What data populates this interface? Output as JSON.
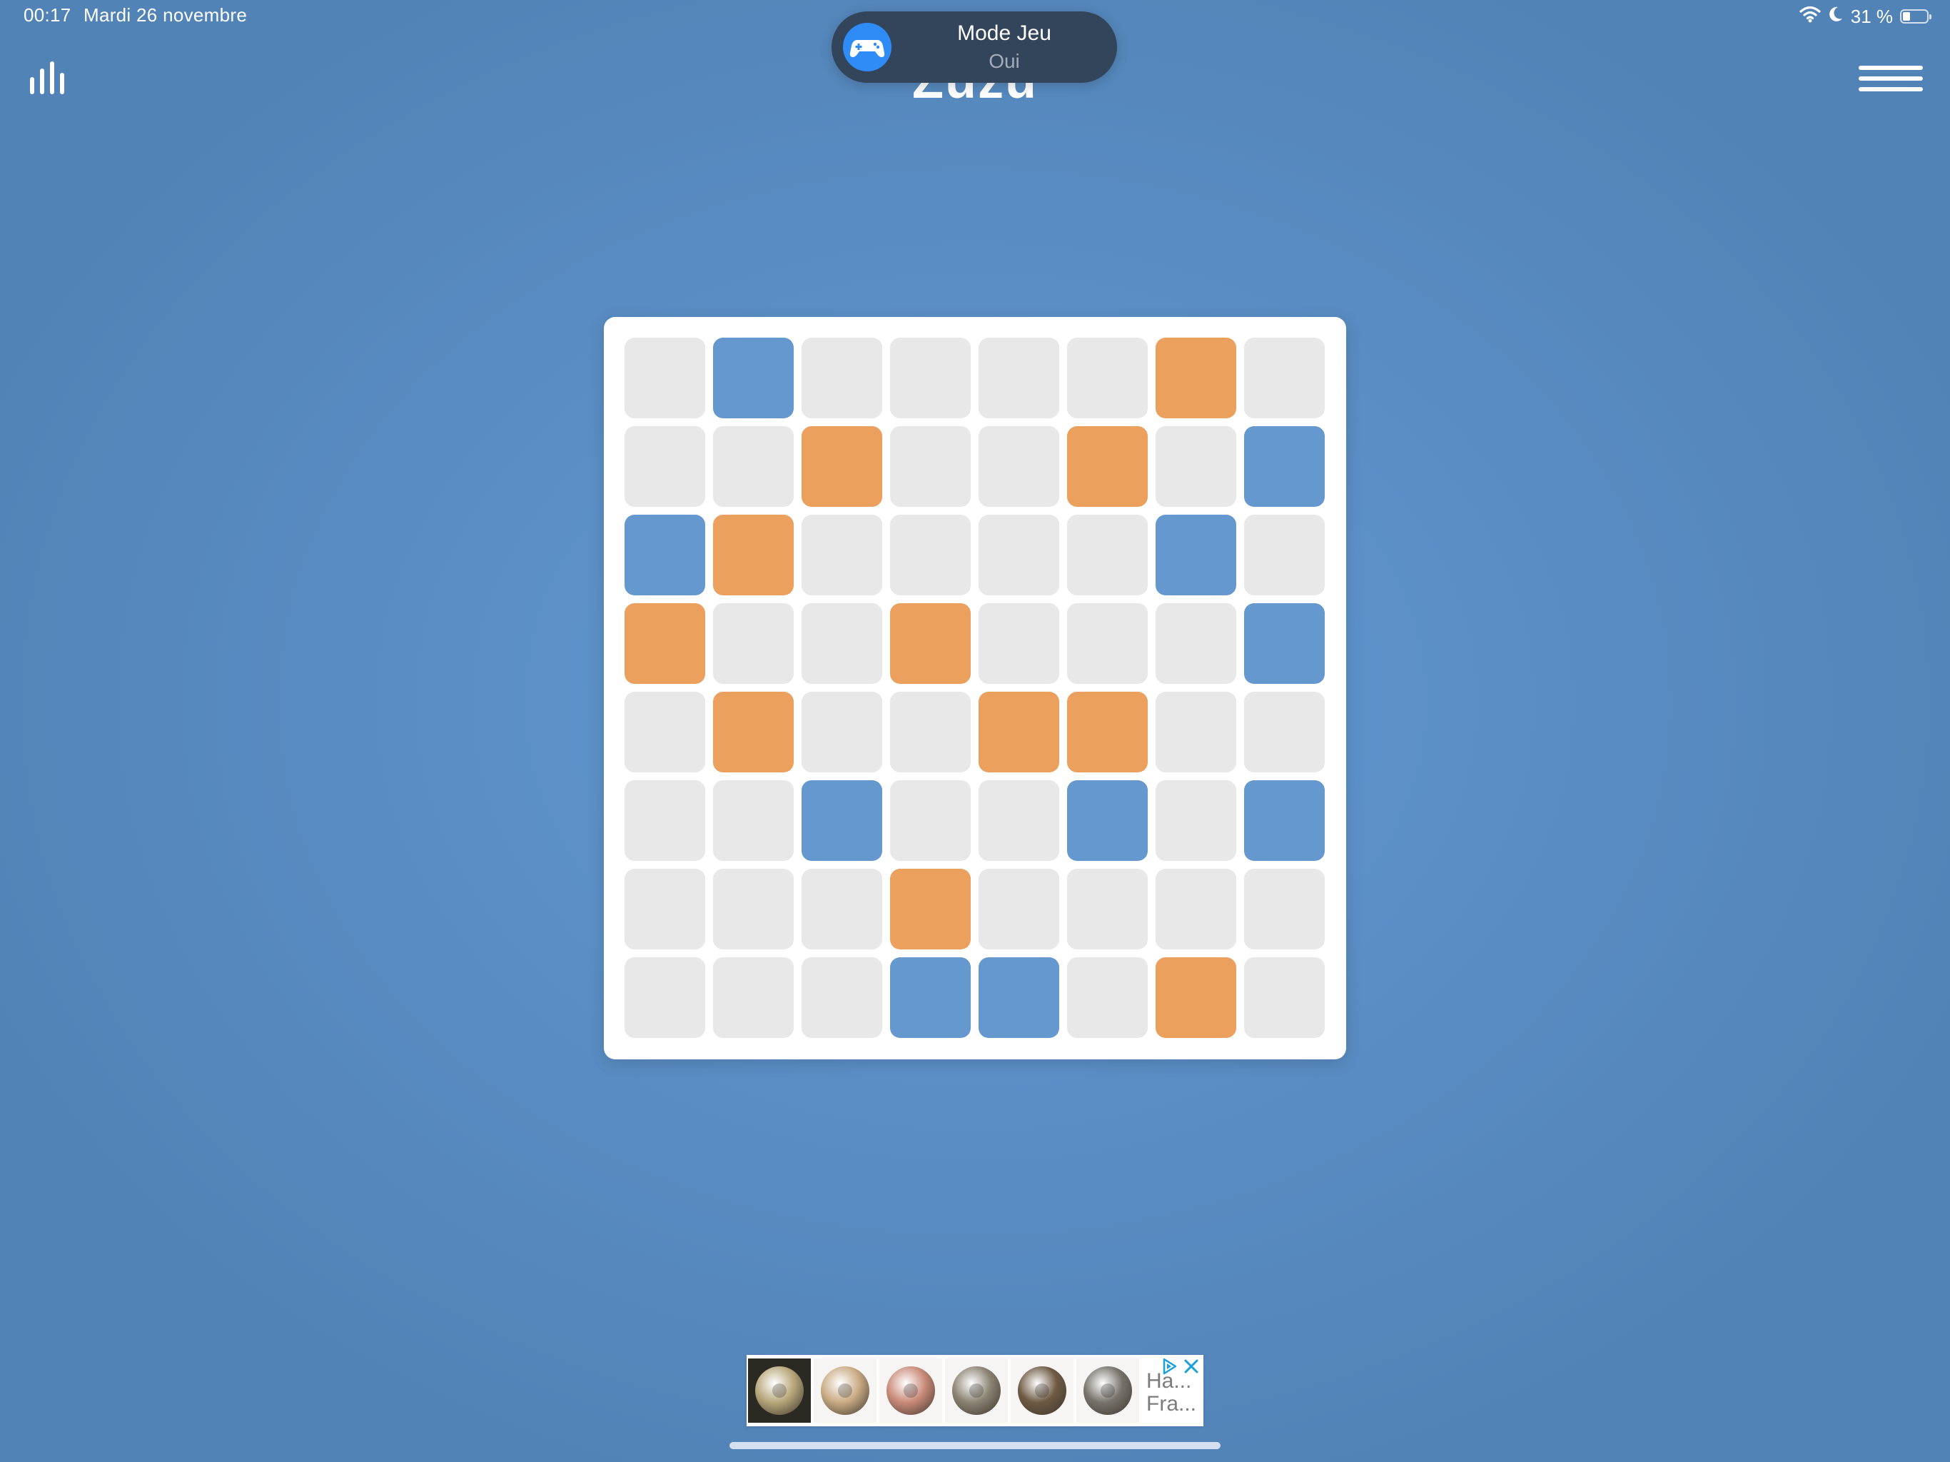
{
  "status_bar": {
    "time": "00:17",
    "date": "Mardi 26 novembre",
    "battery_text": "31 %",
    "battery_level": 0.31,
    "icons": [
      "wifi-icon",
      "moon-icon",
      "battery-icon"
    ]
  },
  "header": {
    "title": "Zuzu",
    "left_icon": "bar-chart-icon",
    "right_icon": "hamburger-menu-icon"
  },
  "game_mode_banner": {
    "title": "Mode Jeu",
    "state": "Oui",
    "icon": "game-controller-icon"
  },
  "board": {
    "rows": 8,
    "columns": 8,
    "colors": {
      "empty": "#e8e8e8",
      "orange": "#eba05e",
      "blue": "#6698d0",
      "background": "#5b8fc6"
    },
    "cells": [
      [
        "empty",
        "blue",
        "empty",
        "empty",
        "empty",
        "empty",
        "orange",
        "empty"
      ],
      [
        "empty",
        "empty",
        "orange",
        "empty",
        "empty",
        "orange",
        "empty",
        "blue"
      ],
      [
        "blue",
        "orange",
        "empty",
        "empty",
        "empty",
        "empty",
        "blue",
        "empty"
      ],
      [
        "orange",
        "empty",
        "empty",
        "orange",
        "empty",
        "empty",
        "empty",
        "blue"
      ],
      [
        "empty",
        "orange",
        "empty",
        "empty",
        "orange",
        "orange",
        "empty",
        "empty"
      ],
      [
        "empty",
        "empty",
        "blue",
        "empty",
        "empty",
        "blue",
        "empty",
        "blue"
      ],
      [
        "empty",
        "empty",
        "empty",
        "orange",
        "empty",
        "empty",
        "empty",
        "empty"
      ],
      [
        "empty",
        "empty",
        "empty",
        "blue",
        "blue",
        "empty",
        "orange",
        "empty"
      ]
    ]
  },
  "ad_banner": {
    "title": "Ha...",
    "subtitle": "Fra...",
    "icons": [
      "ad-choices-icon",
      "close-icon"
    ],
    "thumbnails": [
      {
        "icon": "handpan-drum-icon",
        "bg": "dark",
        "color": "#b7a77a"
      },
      {
        "icon": "handpan-drum-icon",
        "bg": "light",
        "color": "#c9ab84"
      },
      {
        "icon": "handpan-drum-icon",
        "bg": "light",
        "color": "#c98a78"
      },
      {
        "icon": "handpan-drum-icon",
        "bg": "light",
        "color": "#8a8272"
      },
      {
        "icon": "handpan-drum-icon",
        "bg": "light",
        "color": "#6e5a44"
      },
      {
        "icon": "handpan-drum-icon",
        "bg": "light",
        "color": "#77736c"
      }
    ]
  }
}
